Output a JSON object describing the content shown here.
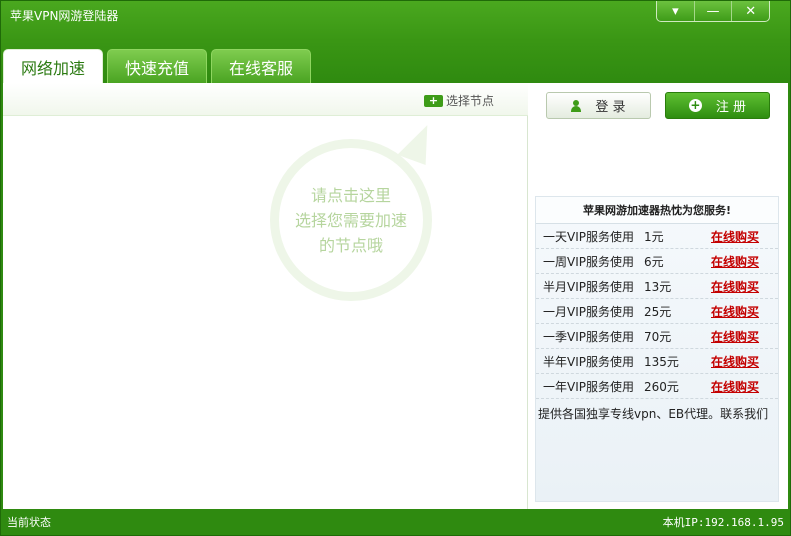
{
  "window": {
    "title": "苹果VPN网游登陆器"
  },
  "window_controls": {
    "menu": "▾",
    "minimize": "—",
    "close": "✕"
  },
  "tabs": [
    {
      "label": "网络加速",
      "active": true
    },
    {
      "label": "快速充值",
      "active": false
    },
    {
      "label": "在线客服",
      "active": false
    }
  ],
  "node_bar": {
    "select_label": "选择节点",
    "select_icon": "+"
  },
  "bubble": {
    "lines": [
      "请点击这里",
      "选择您需要加速",
      "的节点哦"
    ]
  },
  "auth": {
    "login_label": "登 录",
    "register_label": "注 册",
    "register_icon": "+"
  },
  "service": {
    "title": "苹果网游加速器热忱为您服务!",
    "buy_label": "在线购买",
    "rows": [
      {
        "name": "一天VIP服务使用",
        "price": "1元"
      },
      {
        "name": "一周VIP服务使用",
        "price": "6元"
      },
      {
        "name": "半月VIP服务使用",
        "price": "13元"
      },
      {
        "name": "一月VIP服务使用",
        "price": "25元"
      },
      {
        "name": "一季VIP服务使用",
        "price": "70元"
      },
      {
        "name": "半年VIP服务使用",
        "price": "135元"
      },
      {
        "name": "一年VIP服务使用",
        "price": "260元"
      }
    ],
    "note": "提供各国独享专线vpn、EB代理。联系我们"
  },
  "status": {
    "left": "当前状态",
    "ip": "本机IP:192.168.1.95"
  },
  "colors": {
    "brand_green": "#3a9614",
    "buy_red": "#c40000"
  }
}
